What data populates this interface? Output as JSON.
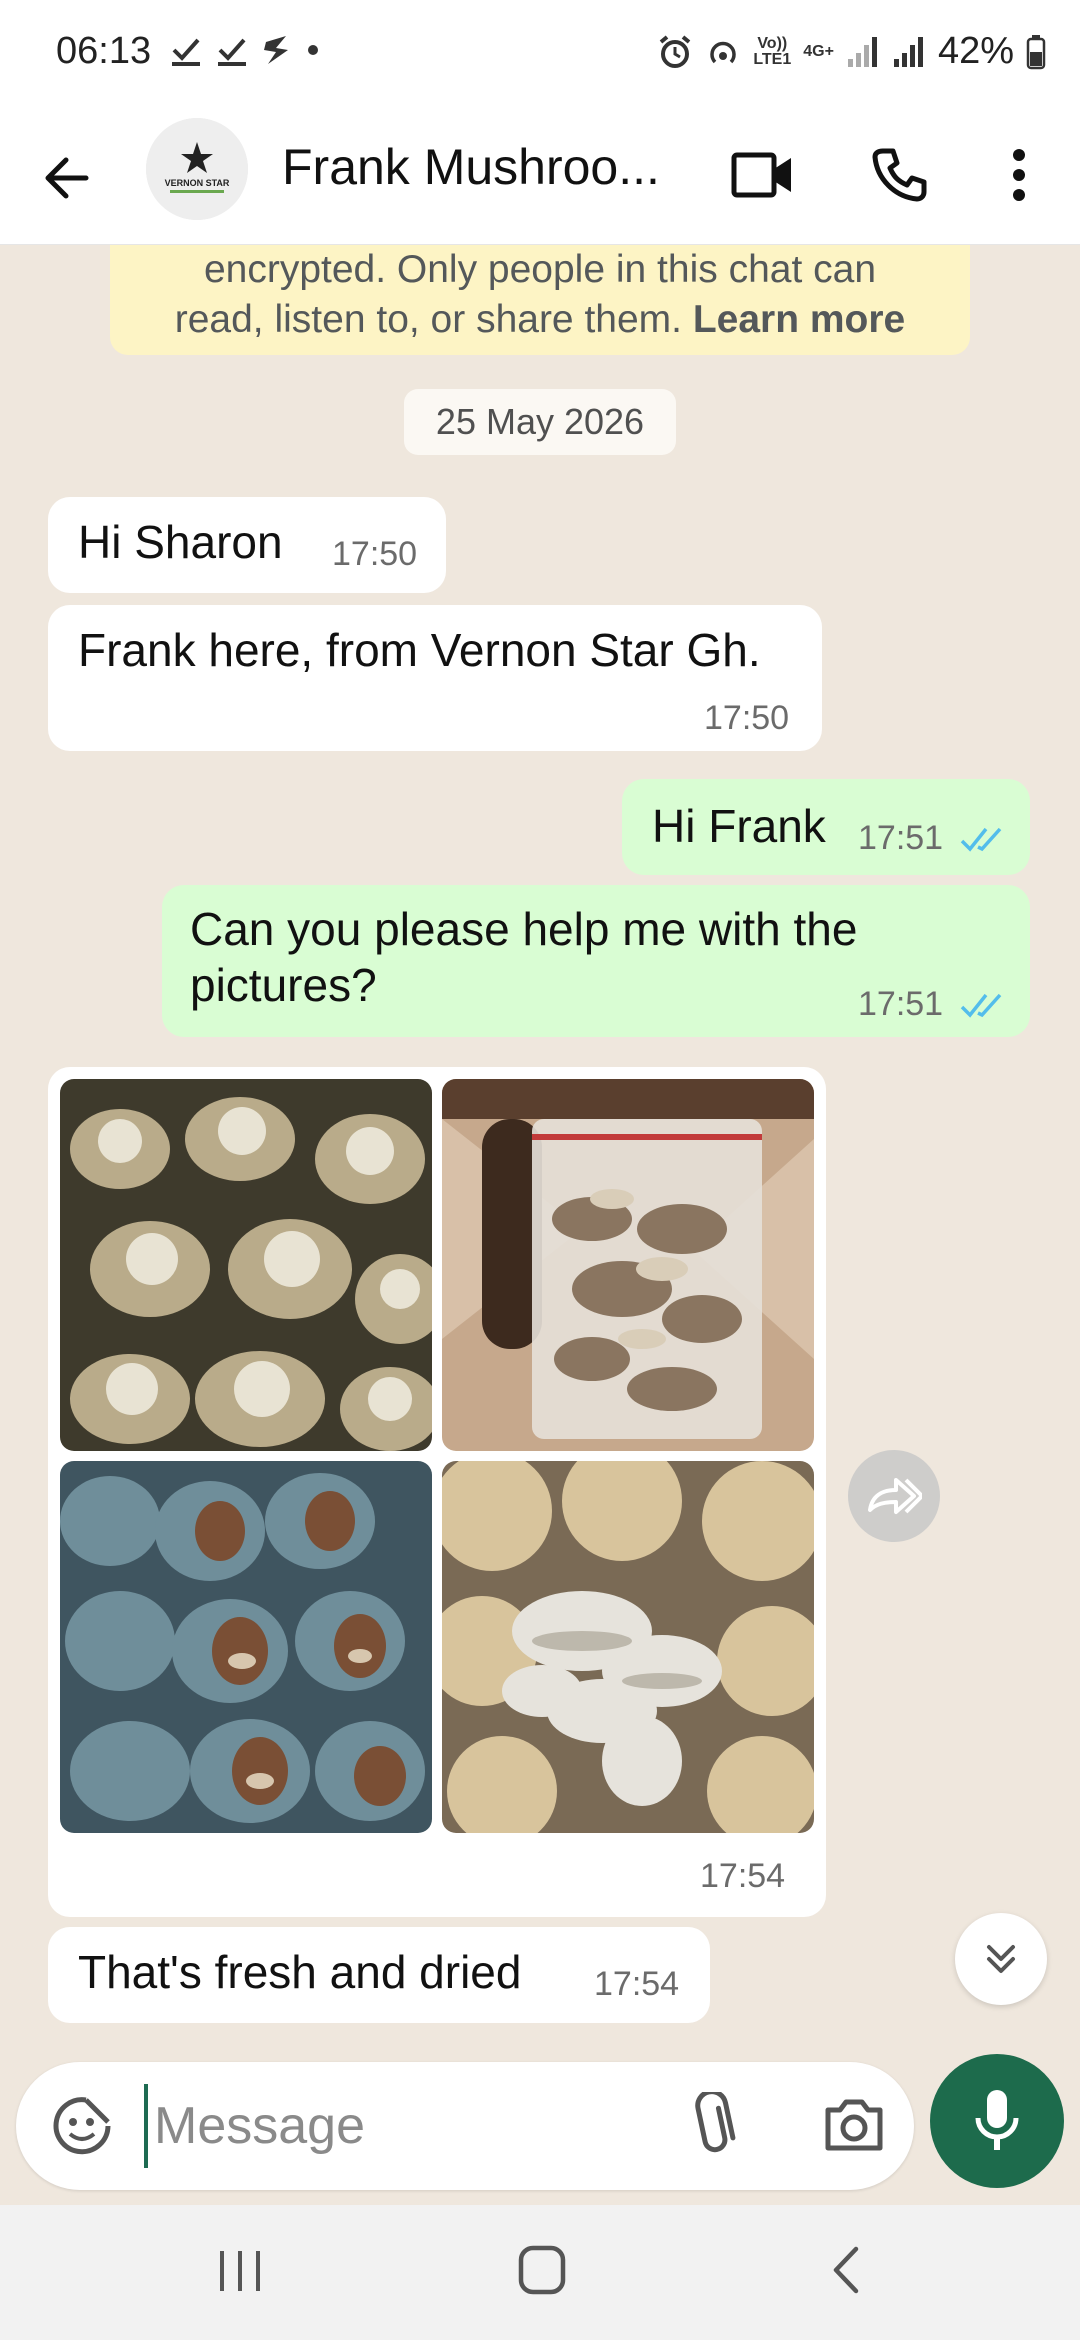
{
  "status_bar": {
    "time": "06:13",
    "battery": "42%",
    "volte": "Vo))\nLTE1",
    "network": "4G+"
  },
  "header": {
    "contact_name": "Frank Mushroo...",
    "avatar_text": "VERNON STAR"
  },
  "chat": {
    "encryption_text": "encrypted. Only people in this chat can",
    "encryption_text2": "read, listen to, or share them.",
    "encryption_link": "Learn more",
    "date": "25 May 2026",
    "messages": [
      {
        "dir": "in",
        "text": "Hi Sharon",
        "time": "17:50"
      },
      {
        "dir": "in",
        "text": "Frank here, from Vernon Star Gh.",
        "time": "17:50"
      },
      {
        "dir": "out",
        "text": "Hi Frank",
        "time": "17:51"
      },
      {
        "dir": "out",
        "text": "Can you please help me with the pictures?",
        "time": "17:51"
      },
      {
        "dir": "in",
        "type": "images",
        "count": 4,
        "time": "17:54"
      },
      {
        "dir": "in",
        "text": "That's fresh and dried",
        "time": "17:54"
      }
    ]
  },
  "input": {
    "placeholder": "Message"
  },
  "icons": {
    "back": "arrow-left-icon",
    "video": "video-call-icon",
    "call": "phone-icon",
    "menu": "more-vert-icon",
    "emoji": "emoji-icon",
    "attach": "paperclip-icon",
    "camera": "camera-icon",
    "mic": "mic-icon",
    "forward": "forward-icon",
    "scroll": "scroll-down-icon"
  },
  "colors": {
    "outgoing": "#d9fdd3",
    "incoming": "#ffffff",
    "accent": "#1d6b4c",
    "tick": "#53bdeb"
  }
}
